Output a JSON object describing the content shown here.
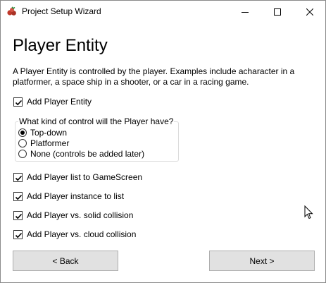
{
  "window": {
    "title": "Project Setup Wizard",
    "icons": {
      "app": "berry-app-icon",
      "minimize": "minimize-icon",
      "maximize": "maximize-icon",
      "close": "close-icon"
    }
  },
  "page": {
    "heading": "Player Entity",
    "description": "A Player Entity is controlled by the player. Examples include acharacter in a platformer, a space ship in a shooter, or a car in a racing game."
  },
  "add_player_entity": {
    "label": "Add Player Entity",
    "checked": true
  },
  "control_group": {
    "label": "What kind of control will the Player have?",
    "options": [
      {
        "label": "Top-down",
        "selected": true
      },
      {
        "label": "Platformer",
        "selected": false
      },
      {
        "label": "None (controls be added later)",
        "selected": false
      }
    ]
  },
  "options": [
    {
      "label": "Add Player list to GameScreen",
      "checked": true
    },
    {
      "label": "Add Player instance to list",
      "checked": true
    },
    {
      "label": "Add Player vs. solid collision",
      "checked": true
    },
    {
      "label": "Add Player vs. cloud collision",
      "checked": true
    }
  ],
  "buttons": {
    "back": "< Back",
    "next": "Next >"
  }
}
